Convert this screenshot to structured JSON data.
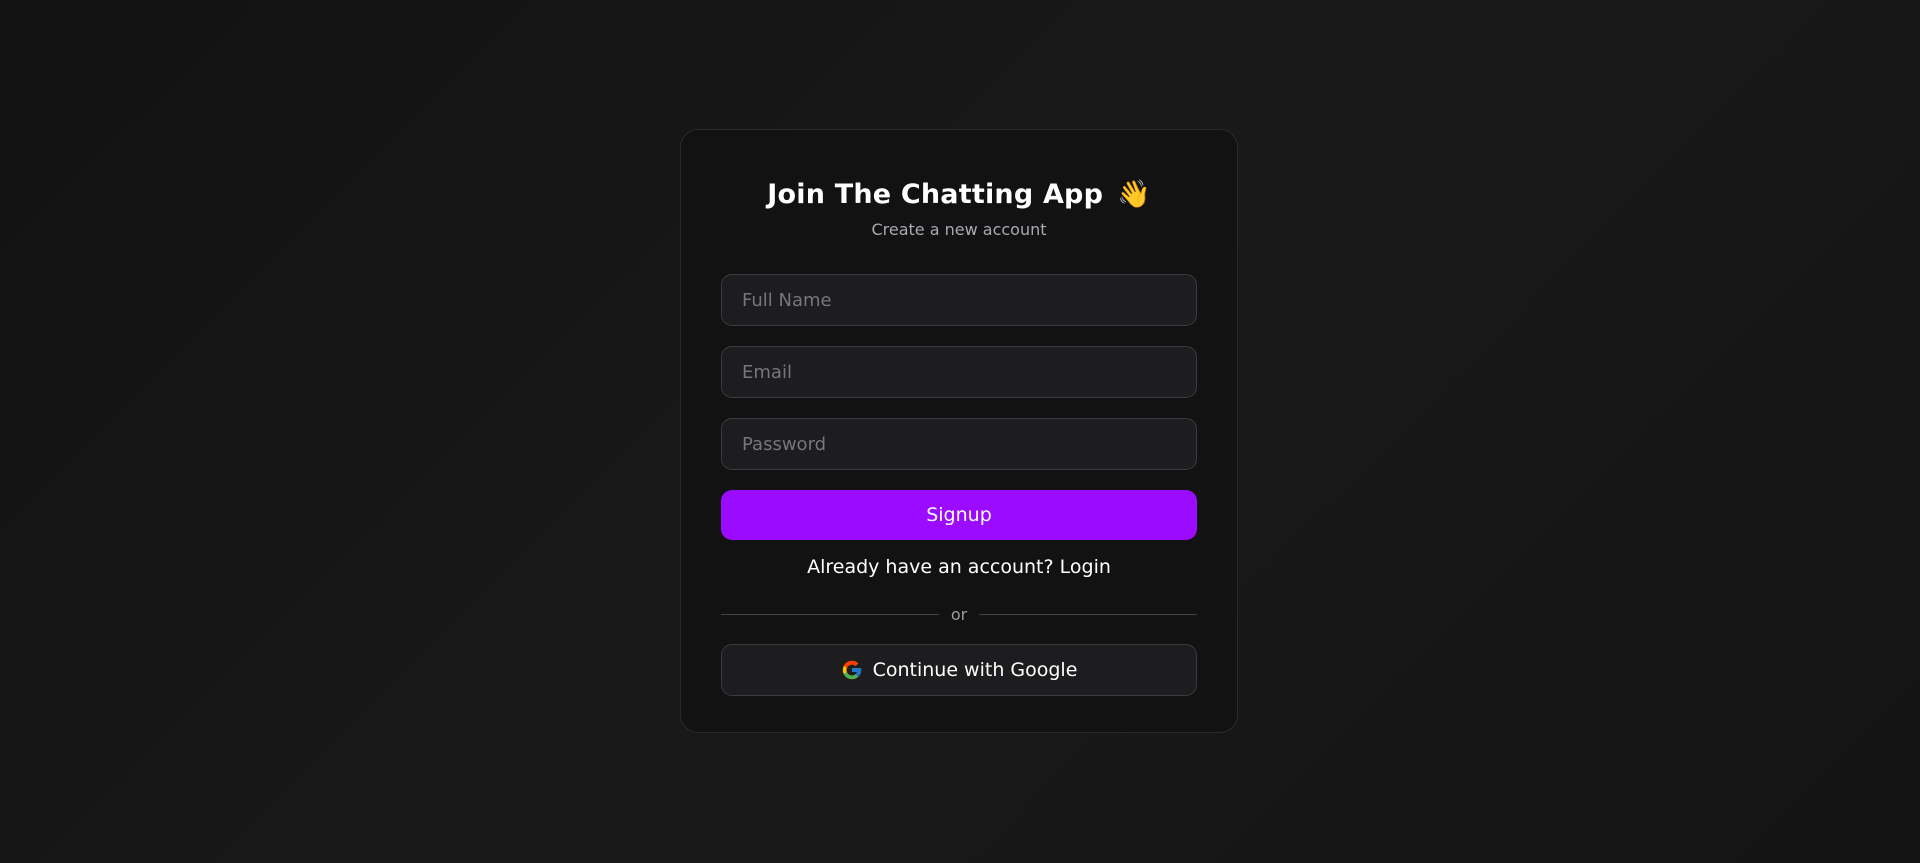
{
  "card": {
    "title": "Join The Chatting App",
    "title_emoji": "👋",
    "subtitle": "Create a new account"
  },
  "form": {
    "name_placeholder": "Full Name",
    "name_value": "",
    "email_placeholder": "Email",
    "email_value": "",
    "password_placeholder": "Password",
    "password_value": "",
    "signup_label": "Signup"
  },
  "login": {
    "prompt": "Already have an account?",
    "link_label": "Login"
  },
  "divider": {
    "label": "or"
  },
  "oauth": {
    "google_label": "Continue with Google",
    "icon": "google-icon"
  },
  "colors": {
    "background": "#141414",
    "card": "#121212",
    "accent": "#9a0bff",
    "input_bg": "#1d1d1f",
    "input_border": "#3a3a40",
    "muted_text": "#a9a9b3"
  }
}
